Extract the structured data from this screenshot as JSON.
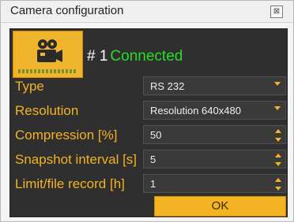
{
  "window": {
    "title": "Camera configuration",
    "close_glyph": "⊠"
  },
  "camera": {
    "icon": "film-camera-icon",
    "number": "# 1",
    "status": "Connected",
    "status_color": "#21e020",
    "accent_color": "#f3b322"
  },
  "fields": {
    "type": {
      "label": "Type",
      "value": "RS 232"
    },
    "resolution": {
      "label": "Resolution",
      "value": "Resolution 640x480"
    },
    "compression": {
      "label": "Compression [%]",
      "value": "50"
    },
    "snapshot": {
      "label": "Snapshot interval [s]",
      "value": "5"
    },
    "limit": {
      "label": "Limit/file record [h]",
      "value": "1"
    }
  },
  "ok_label": "OK"
}
